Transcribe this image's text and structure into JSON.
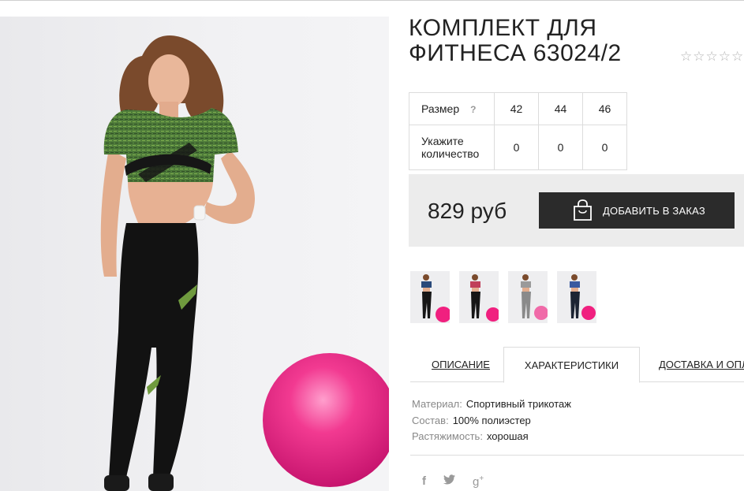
{
  "product": {
    "title": "КОМПЛЕКТ ДЛЯ ФИТНЕСА 63024/2",
    "rating_stars": 5
  },
  "size_table": {
    "size_label": "Размер",
    "help_mark": "?",
    "sizes": [
      "42",
      "44",
      "46"
    ],
    "qty_label": "Укажите количество",
    "quantities": [
      "0",
      "0",
      "0"
    ]
  },
  "purchase": {
    "price": "829 руб",
    "add_button": "ДОБАВИТЬ В ЗАКАЗ"
  },
  "tabs": [
    {
      "label": "ОПИСАНИЕ",
      "active": false
    },
    {
      "label": "ХАРАКТЕРИСТИКИ",
      "active": true
    },
    {
      "label": "ДОСТАВКА И ОПЛАТА",
      "active": false
    }
  ],
  "specs": [
    {
      "key": "Материал:",
      "value": "Спортивный трикотаж"
    },
    {
      "key": "Состав:",
      "value": "100% полиэстер"
    },
    {
      "key": "Растяжимость:",
      "value": "хорошая"
    }
  ],
  "social": [
    {
      "icon": "facebook-icon",
      "glyph": "f"
    },
    {
      "icon": "twitter-icon",
      "glyph": "🐦"
    },
    {
      "icon": "google-plus-icon",
      "glyph": "g+"
    }
  ],
  "colors": {
    "button_bg": "#2b2b2b",
    "price_bar_bg": "#ececec",
    "top_accent": "#3f7a3a",
    "ball": "#f0207f"
  }
}
